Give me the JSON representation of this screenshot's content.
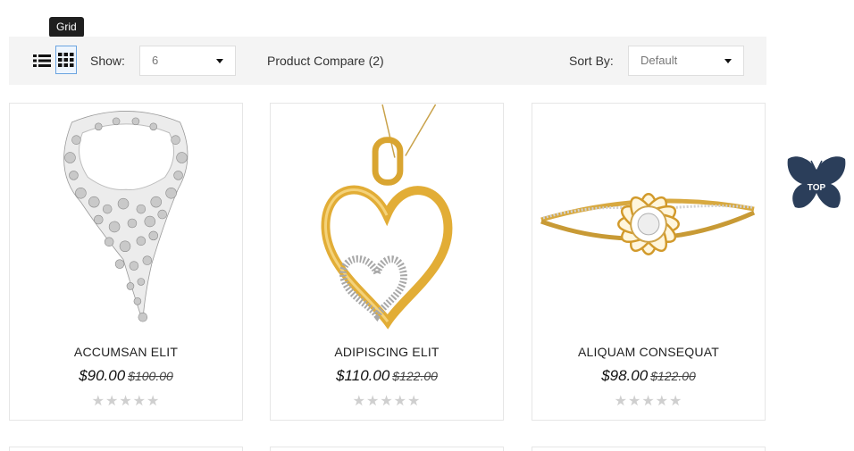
{
  "tooltip": "Grid",
  "toolbar": {
    "show_label": "Show:",
    "show_value": "6",
    "compare_label": "Product Compare (2)",
    "sort_label": "Sort By:",
    "sort_value": "Default"
  },
  "products": [
    {
      "name": "ACCUMSAN ELIT",
      "price": "$90.00",
      "old_price": "$100.00",
      "stars": "★★★★★",
      "image": "silver-necklace"
    },
    {
      "name": "ADIPISCING ELIT",
      "price": "$110.00",
      "old_price": "$122.00",
      "stars": "★★★★★",
      "image": "gold-heart-pendant"
    },
    {
      "name": "ALIQUAM CONSEQUAT",
      "price": "$98.00",
      "old_price": "$122.00",
      "stars": "★★★★★",
      "image": "gold-flower-bangle"
    }
  ],
  "top_button": {
    "label": "TOP",
    "color": "#2b3e5a"
  }
}
